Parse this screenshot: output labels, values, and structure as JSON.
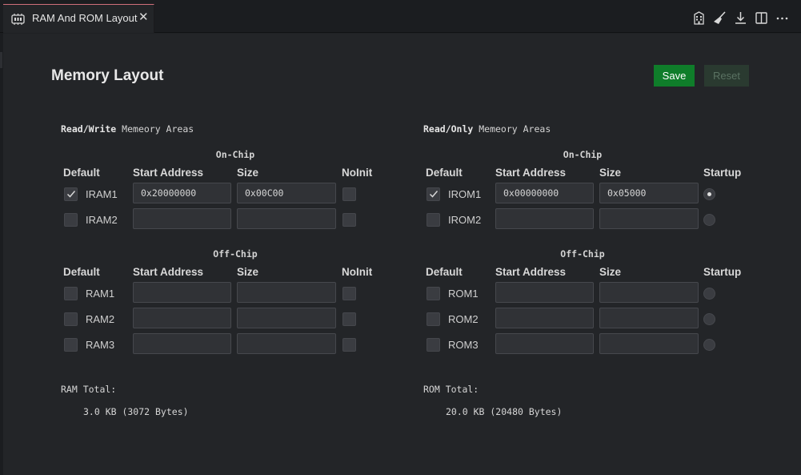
{
  "tab": {
    "title": "RAM And ROM Layout",
    "icon": "memory-chip-icon",
    "close": "✕"
  },
  "toolbar_icons": [
    "building-icon",
    "broom-icon",
    "download-icon",
    "split-editor-icon",
    "more-actions-icon"
  ],
  "page": {
    "title": "Memory Layout",
    "save_label": "Save",
    "reset_label": "Reset"
  },
  "colors": {
    "save": "#0f7d2a",
    "reset": "#2a3a30",
    "tab_accent": "#d06f7a",
    "background": "#232528"
  },
  "ram": {
    "heading_bold": "Read/Write",
    "heading_rest": " Memeory Areas",
    "onchip_label": "On-Chip",
    "offchip_label": "Off-Chip",
    "columns": {
      "default": "Default",
      "start": "Start Address",
      "size": "Size",
      "extra": "NoInit"
    },
    "onchip": [
      {
        "name": "IRAM1",
        "checked": true,
        "start": "0x20000000",
        "size": "0x00C00",
        "noinit": false
      },
      {
        "name": "IRAM2",
        "checked": false,
        "start": "",
        "size": "",
        "noinit": false
      }
    ],
    "offchip": [
      {
        "name": "RAM1",
        "checked": false,
        "start": "",
        "size": "",
        "noinit": false
      },
      {
        "name": "RAM2",
        "checked": false,
        "start": "",
        "size": "",
        "noinit": false
      },
      {
        "name": "RAM3",
        "checked": false,
        "start": "",
        "size": "",
        "noinit": false
      }
    ],
    "total_label": "RAM Total:",
    "total_value": "3.0 KB (3072 Bytes)"
  },
  "rom": {
    "heading_bold": "Read/Only",
    "heading_rest": " Memeory Areas",
    "onchip_label": "On-Chip",
    "offchip_label": "Off-Chip",
    "columns": {
      "default": "Default",
      "start": "Start Address",
      "size": "Size",
      "extra": "Startup"
    },
    "onchip": [
      {
        "name": "IROM1",
        "checked": true,
        "start": "0x00000000",
        "size": "0x05000",
        "startup": true
      },
      {
        "name": "IROM2",
        "checked": false,
        "start": "",
        "size": "",
        "startup": false
      }
    ],
    "offchip": [
      {
        "name": "ROM1",
        "checked": false,
        "start": "",
        "size": "",
        "startup": false
      },
      {
        "name": "ROM2",
        "checked": false,
        "start": "",
        "size": "",
        "startup": false
      },
      {
        "name": "ROM3",
        "checked": false,
        "start": "",
        "size": "",
        "startup": false
      }
    ],
    "total_label": "ROM Total:",
    "total_value": "20.0 KB (20480 Bytes)"
  }
}
